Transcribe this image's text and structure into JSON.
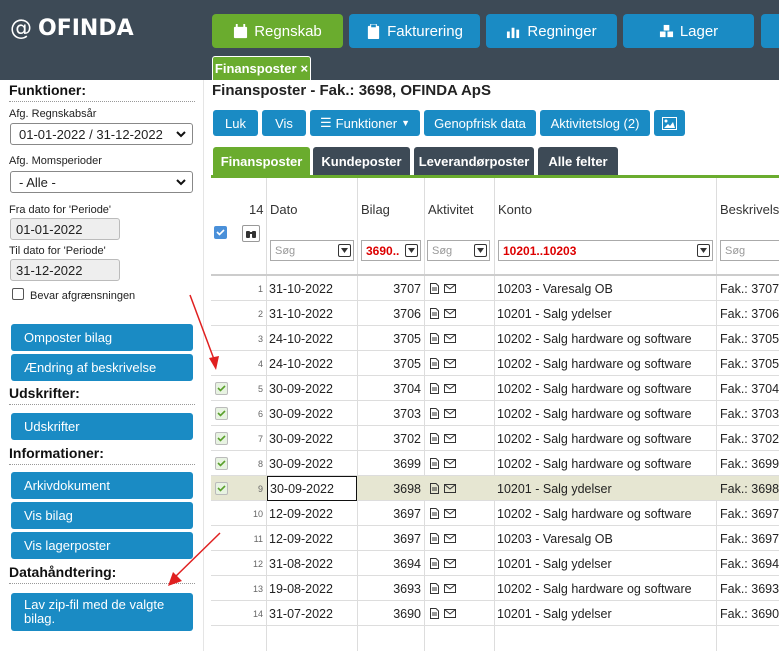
{
  "app": {
    "logo": "OFINDA"
  },
  "nav": {
    "items": [
      {
        "label": "Regnskab",
        "icon": "calendar-icon",
        "active": true
      },
      {
        "label": "Fakturering",
        "icon": "clipboard-icon",
        "active": false
      },
      {
        "label": "Regninger",
        "icon": "bar-chart-icon",
        "active": false
      },
      {
        "label": "Lager",
        "icon": "cubes-icon",
        "active": false
      }
    ],
    "subtab": {
      "label": "Finansposter",
      "close": "×"
    }
  },
  "sidebar": {
    "functions_title": "Funktioner:",
    "fiscal_year_label": "Afg. Regnskabsår",
    "fiscal_year_value": "01-01-2022 / 31-12-2022",
    "vat_label": "Afg. Momsperioder",
    "vat_value": "- Alle -",
    "from_label": "Fra dato for 'Periode'",
    "from_value": "01-01-2022",
    "to_label": "Til dato for 'Periode'",
    "to_value": "31-12-2022",
    "keep_label": "Bevar afgrænsningen",
    "btn_ompost": "Omposter bilag",
    "btn_aendring": "Ændring af beskrivelse",
    "print_title": "Udskrifter:",
    "btn_print": "Udskrifter",
    "info_title": "Informationer:",
    "btn_arkiv": "Arkivdokument",
    "btn_visbilag": "Vis bilag",
    "btn_lager": "Vis lagerposter",
    "data_title": "Datahåndtering:",
    "btn_zip_1": "Lav zip-fil med de valgte",
    "btn_zip_2": "bilag."
  },
  "main": {
    "title": "Finansposter - Fak.: 3698, OFINDA ApS",
    "toolbar": {
      "luk": "Luk",
      "vis": "Vis",
      "funktioner": "Funktioner",
      "genopfrisk": "Genopfrisk data",
      "aktivitetslog": "Aktivitetslog (2)"
    },
    "tabs": [
      "Finansposter",
      "Kundeposter",
      "Leverandørposter",
      "Alle felter"
    ],
    "table": {
      "count": "14",
      "headers": {
        "dato": "Dato",
        "bilag": "Bilag",
        "aktivitet": "Aktivitet",
        "konto": "Konto",
        "beskrivelse": "Beskrivelse"
      },
      "filters": {
        "dato": "Søg",
        "bilag": "3690..",
        "aktivitet": "Søg",
        "konto": "10201..10203",
        "beskrivelse": "Søg"
      },
      "rows": [
        {
          "n": "1",
          "checked": false,
          "dato": "31-10-2022",
          "bilag": "3707",
          "konto": "10203 - Varesalg OB",
          "beskr": "Fak.: 3707"
        },
        {
          "n": "2",
          "checked": false,
          "dato": "31-10-2022",
          "bilag": "3706",
          "konto": "10201 - Salg ydelser",
          "beskr": "Fak.: 3706"
        },
        {
          "n": "3",
          "checked": false,
          "dato": "24-10-2022",
          "bilag": "3705",
          "konto": "10202 - Salg hardware og software",
          "beskr": "Fak.: 3705"
        },
        {
          "n": "4",
          "checked": false,
          "dato": "24-10-2022",
          "bilag": "3705",
          "konto": "10202 - Salg hardware og software",
          "beskr": "Fak.: 3705"
        },
        {
          "n": "5",
          "checked": true,
          "dato": "30-09-2022",
          "bilag": "3704",
          "konto": "10202 - Salg hardware og software",
          "beskr": "Fak.: 3704"
        },
        {
          "n": "6",
          "checked": true,
          "dato": "30-09-2022",
          "bilag": "3703",
          "konto": "10202 - Salg hardware og software",
          "beskr": "Fak.: 3703"
        },
        {
          "n": "7",
          "checked": true,
          "dato": "30-09-2022",
          "bilag": "3702",
          "konto": "10202 - Salg hardware og software",
          "beskr": "Fak.: 3702"
        },
        {
          "n": "8",
          "checked": true,
          "dato": "30-09-2022",
          "bilag": "3699",
          "konto": "10202 - Salg hardware og software",
          "beskr": "Fak.: 3699"
        },
        {
          "n": "9",
          "checked": true,
          "dato": "30-09-2022",
          "bilag": "3698",
          "konto": "10201 - Salg ydelser",
          "beskr": "Fak.: 3698"
        },
        {
          "n": "10",
          "checked": false,
          "dato": "12-09-2022",
          "bilag": "3697",
          "konto": "10202 - Salg hardware og software",
          "beskr": "Fak.: 3697"
        },
        {
          "n": "11",
          "checked": false,
          "dato": "12-09-2022",
          "bilag": "3697",
          "konto": "10203 - Varesalg OB",
          "beskr": "Fak.: 3697"
        },
        {
          "n": "12",
          "checked": false,
          "dato": "31-08-2022",
          "bilag": "3694",
          "konto": "10201 - Salg ydelser",
          "beskr": "Fak.: 3694"
        },
        {
          "n": "13",
          "checked": false,
          "dato": "19-08-2022",
          "bilag": "3693",
          "konto": "10202 - Salg hardware og software",
          "beskr": "Fak.: 3693"
        },
        {
          "n": "14",
          "checked": false,
          "dato": "31-07-2022",
          "bilag": "3690",
          "konto": "10201 - Salg ydelser",
          "beskr": "Fak.: 3690"
        }
      ]
    }
  },
  "colors": {
    "green": "#6aac2e",
    "blue": "#1a8bc4",
    "dark": "#3d4a56",
    "arrow": "#e02020"
  }
}
